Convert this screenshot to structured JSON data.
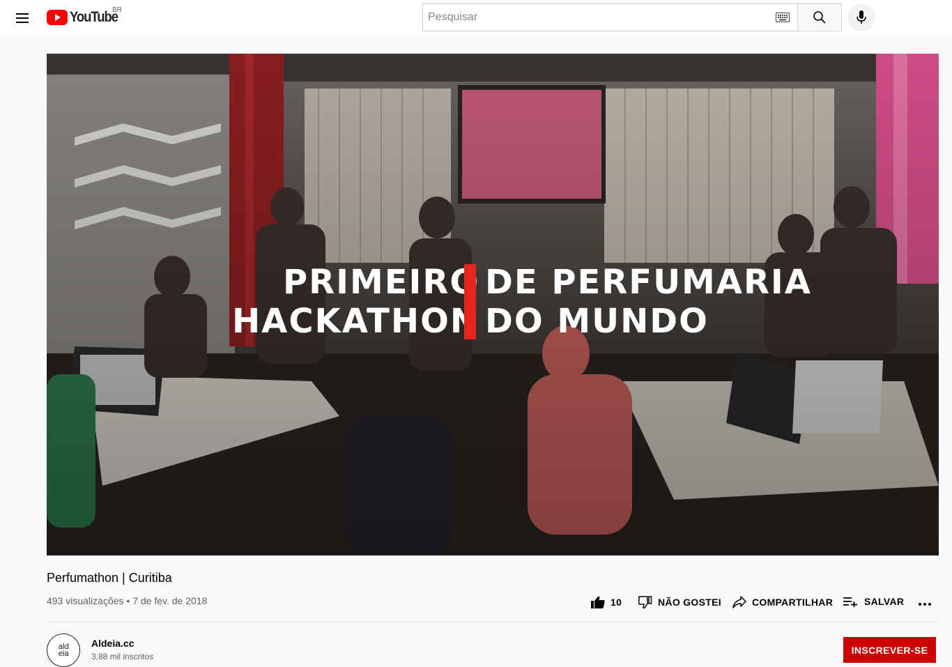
{
  "header": {
    "logo_text": "YouTube",
    "country_code": "BR",
    "search_placeholder": "Pesquisar",
    "brand_red": "#ff0000"
  },
  "player": {
    "overlay_line1_left": "PRIMEIRO",
    "overlay_line1_right": "DE PERFUMARIA",
    "overlay_line2_left": "HACKATHON",
    "overlay_line2_right": "DO MUNDO",
    "accent": "#e5261c"
  },
  "video": {
    "title": "Perfumathon | Curitiba",
    "views": "493 visualizações",
    "separator": "•",
    "date": "7 de fev. de 2018"
  },
  "actions": {
    "like_count": "10",
    "dislike_label": "NÃO GOSTEI",
    "share_label": "COMPARTILHAR",
    "save_label": "SALVAR"
  },
  "channel": {
    "name": "Aldeia.cc",
    "subscribers": "3,88 mil inscritos",
    "avatar_line1": "ald",
    "avatar_line2": "eia",
    "subscribe_label": "INSCREVER-SE",
    "subscribe_color": "#cc0000"
  }
}
